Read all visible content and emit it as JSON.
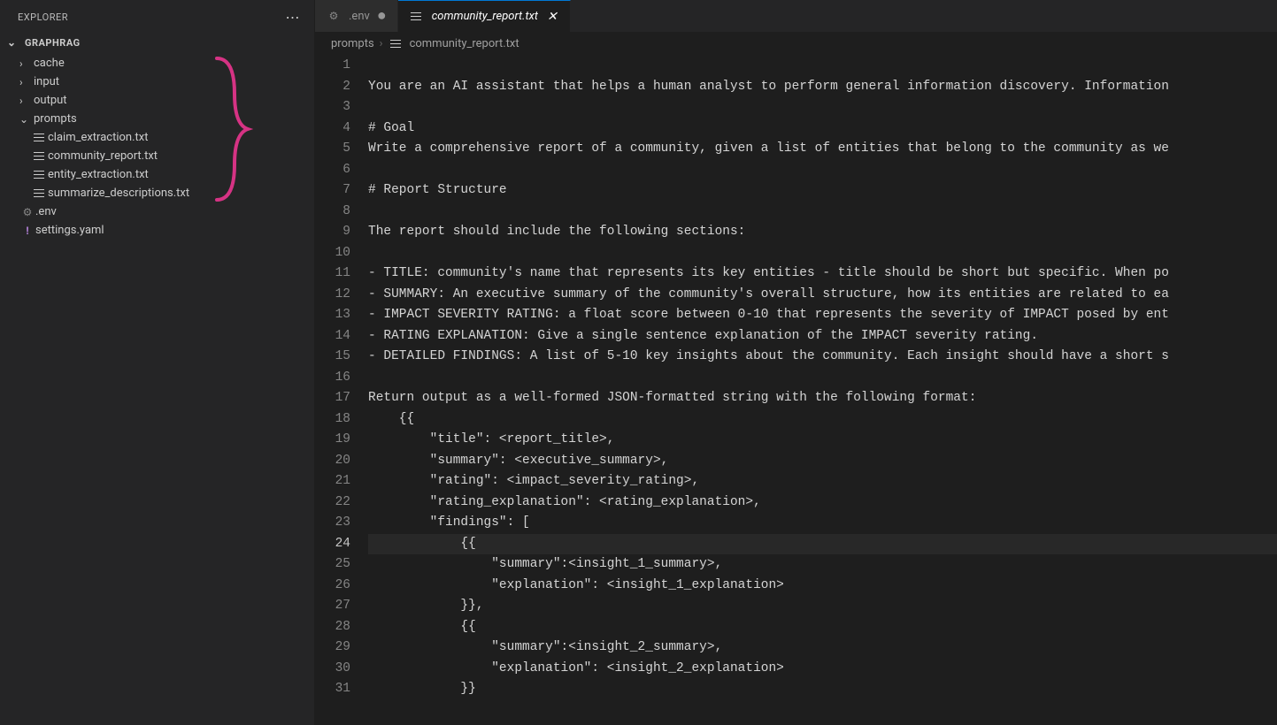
{
  "explorer": {
    "title": "EXPLORER",
    "root": "GRAPHRAG",
    "tree": [
      {
        "type": "folder",
        "name": "cache",
        "expanded": false,
        "indent": 0
      },
      {
        "type": "folder",
        "name": "input",
        "expanded": false,
        "indent": 0
      },
      {
        "type": "folder",
        "name": "output",
        "expanded": false,
        "indent": 0
      },
      {
        "type": "folder",
        "name": "prompts",
        "expanded": true,
        "indent": 0
      },
      {
        "type": "file",
        "name": "claim_extraction.txt",
        "icon": "text",
        "indent": 1
      },
      {
        "type": "file",
        "name": "community_report.txt",
        "icon": "text",
        "indent": 1
      },
      {
        "type": "file",
        "name": "entity_extraction.txt",
        "icon": "text",
        "indent": 1
      },
      {
        "type": "file",
        "name": "summarize_descriptions.txt",
        "icon": "text",
        "indent": 1
      },
      {
        "type": "file",
        "name": ".env",
        "icon": "gear",
        "indent": 0
      },
      {
        "type": "file",
        "name": "settings.yaml",
        "icon": "exclaim",
        "indent": 0
      }
    ]
  },
  "tabs": [
    {
      "label": ".env",
      "icon": "gear",
      "dirty": true,
      "active": false
    },
    {
      "label": "community_report.txt",
      "icon": "text",
      "dirty": false,
      "active": true
    }
  ],
  "breadcrumbs": {
    "segments": [
      "prompts",
      "community_report.txt"
    ]
  },
  "editor": {
    "activeLine": 24,
    "lines": [
      "",
      "You are an AI assistant that helps a human analyst to perform general information discovery. Information",
      "",
      "# Goal",
      "Write a comprehensive report of a community, given a list of entities that belong to the community as we",
      "",
      "# Report Structure",
      "",
      "The report should include the following sections:",
      "",
      "- TITLE: community's name that represents its key entities - title should be short but specific. When po",
      "- SUMMARY: An executive summary of the community's overall structure, how its entities are related to ea",
      "- IMPACT SEVERITY RATING: a float score between 0-10 that represents the severity of IMPACT posed by ent",
      "- RATING EXPLANATION: Give a single sentence explanation of the IMPACT severity rating.",
      "- DETAILED FINDINGS: A list of 5-10 key insights about the community. Each insight should have a short s",
      "",
      "Return output as a well-formed JSON-formatted string with the following format:",
      "    {{",
      "        \"title\": <report_title>,",
      "        \"summary\": <executive_summary>,",
      "        \"rating\": <impact_severity_rating>,",
      "        \"rating_explanation\": <rating_explanation>,",
      "        \"findings\": [",
      "            {{",
      "                \"summary\":<insight_1_summary>,",
      "                \"explanation\": <insight_1_explanation>",
      "            }},",
      "            {{",
      "                \"summary\":<insight_2_summary>,",
      "                \"explanation\": <insight_2_explanation>",
      "            }}"
    ]
  }
}
